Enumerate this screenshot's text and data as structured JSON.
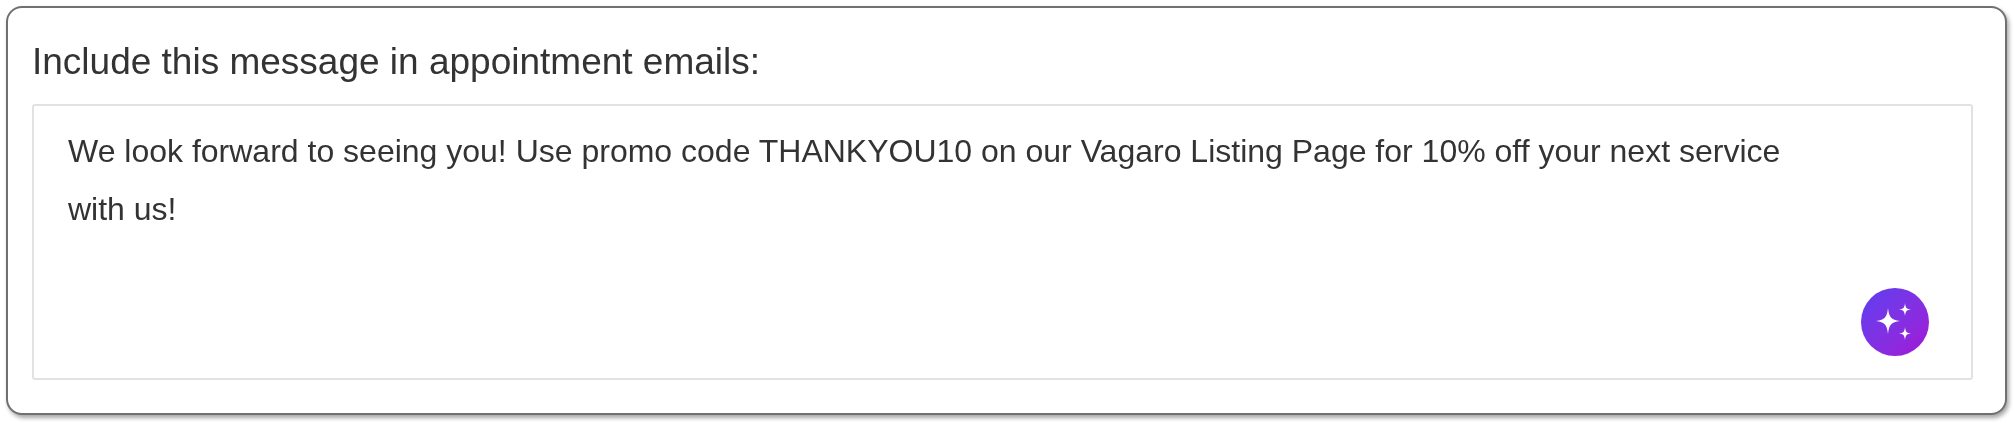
{
  "label": "Include this message in appointment emails:",
  "message": {
    "value": "We look forward to seeing you! Use promo code THANKYOU10 on our Vagaro Listing Page for 10% off your next service with us!"
  }
}
